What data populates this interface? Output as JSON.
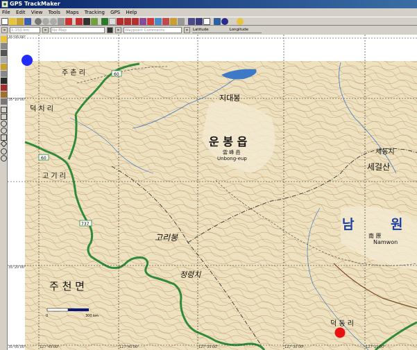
{
  "window": {
    "title": "GPS TrackMaker"
  },
  "menu": [
    "File",
    "Edit",
    "View",
    "Tools",
    "Maps",
    "Tracking",
    "GPS",
    "Help"
  ],
  "toolbar2": {
    "scale_value": "1:150 km",
    "map_value": "No Map",
    "waypoint_placeholder": "Waypoint Comments",
    "latitude_label": "Latitude",
    "longitude_label": "Longitude"
  },
  "map": {
    "coords_left": [
      "35°05'00\"",
      "35°10'00\"",
      "35°20'00\"",
      "35°05'00\""
    ],
    "coords_bottom": [
      "127°45'00\"",
      "127°40'00\"",
      "127°35'00\"",
      "127°30'00\"",
      "127°25'00\""
    ],
    "labels": {
      "juchonri": "주 촌 리",
      "deokchiri": "덕 치 리",
      "gogiri": "고 기 리",
      "unbongeup": "운  봉  읍",
      "unbongeup_hanja": "雲 峰 邑",
      "unbongeup_en": "Unbong-eup",
      "nam": "남",
      "won": "원",
      "namwon_hanja": "南 原",
      "namwon_en": "Namwon",
      "juchunmyeon": "주     천     면",
      "goribong": "고리봉",
      "jeongryeongchi": "정령치",
      "sedongchi": "세동치",
      "segeolsan": "세걸산",
      "jidaebong": "지대봉",
      "deokdongri": "덕 동 리",
      "road_60a": "60",
      "road_60b": "60",
      "road_737": "737",
      "scale_text": "0",
      "scale_end": "300 km"
    }
  },
  "colors": {
    "route_green": "#2f8a3a",
    "start_marker": "#1f2bff",
    "end_marker": "#e81010",
    "river_blue": "#3d79c7",
    "contour": "#c49a6c",
    "map_bg": "#efe3c2"
  }
}
